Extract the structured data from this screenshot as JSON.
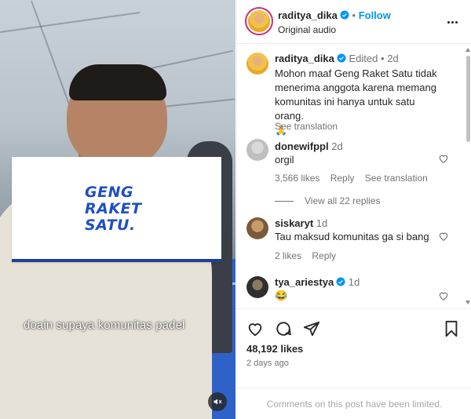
{
  "media": {
    "logo_text": "GENG\nRAKET\nSATU.",
    "caption": "doain supaya komunitas padel"
  },
  "header": {
    "username": "raditya_dika",
    "separator": "•",
    "follow_label": "Follow",
    "audio_label": "Original audio"
  },
  "caption_comment": {
    "username": "raditya_dika",
    "edited": "Edited",
    "separator": "•",
    "time": "2d",
    "text": "Mohon maaf Geng Raket Satu tidak menerima anggota karena memang komunitas ini hanya untuk satu orang.",
    "emoji": "🙏",
    "see_translation": "See translation"
  },
  "comments": [
    {
      "username": "donewifppl",
      "time": "2d",
      "text": "orgil",
      "likes": "3,566 likes",
      "reply": "Reply",
      "see_translation": "See translation",
      "view_replies": "View all 22 replies"
    },
    {
      "username": "siskaryt",
      "time": "1d",
      "text": "Tau maksud komunitas ga si bang",
      "likes": "2 likes",
      "reply": "Reply"
    },
    {
      "username": "tya_ariestya",
      "time": "1d",
      "text": "😂"
    }
  ],
  "footer": {
    "likes": "48,192 likes",
    "date": "2 days ago",
    "limited_notice": "Comments on this post have been limited."
  },
  "colors": {
    "accent": "#0095f6",
    "logo_blue": "#1f4fc4",
    "court_blue": "#2f62c9"
  },
  "icons": [
    "volume-icon",
    "verified-badge-icon",
    "more-options-icon",
    "heart-icon",
    "comment-icon",
    "share-icon",
    "bookmark-icon"
  ]
}
